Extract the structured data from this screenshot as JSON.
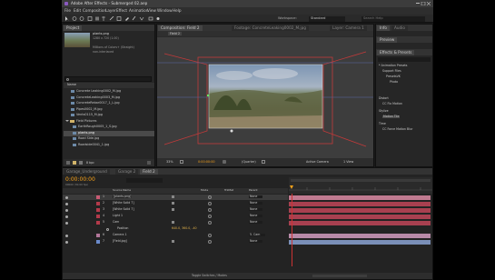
{
  "window": {
    "title": "Adobe After Effects - Submerged 02.aep"
  },
  "menu": [
    "File",
    "Edit",
    "Composition",
    "Layer",
    "Effect",
    "Animation",
    "View",
    "Window",
    "Help"
  ],
  "toolbar": {
    "workspace_label": "Workspace:",
    "workspace_value": "Standard",
    "search_placeholder": "Search Help"
  },
  "project": {
    "tab": "Project",
    "preview_name": "plants.png",
    "preview_info_1": "1280 x 720 (1.00)",
    "preview_info_2": "Millions of Colors+ (Straight)",
    "preview_info_3": "non-interlaced",
    "column_name": "Name",
    "items": [
      {
        "name": "Concrete Leaking0002_M.jpg",
        "type": "file"
      },
      {
        "name": "ConcreteLeaking0003_M.jpg",
        "type": "file"
      },
      {
        "name": "ConcreteRebar0017_1_L.jpg",
        "type": "file"
      },
      {
        "name": "Pipes0002_M.jpg",
        "type": "file"
      },
      {
        "name": "Vents0115_M.jpg",
        "type": "file"
      },
      {
        "name": "Field Pictures",
        "type": "folder"
      },
      {
        "name": "EarthRough0005_1_S.jpg",
        "type": "file"
      },
      {
        "name": "plants.png",
        "type": "file",
        "selected": true
      },
      {
        "name": "Road Side.jpg",
        "type": "file"
      },
      {
        "name": "Roadside0041_1.jpg",
        "type": "file"
      }
    ],
    "bpc": "8 bpc"
  },
  "composition": {
    "tab_comp": "Composition: Field 2",
    "tab_footage": "Footage: ConcreteLeaking0002_M.jpg",
    "tab_layer": "Layer: Camera 1",
    "breadcrumb": "Field 2",
    "zoom": "33%",
    "resolution": "(Quarter)",
    "view": "Active Camera",
    "views_count": "1 View",
    "timecode": "0:00:00:00"
  },
  "right_panel": {
    "info_tab": "Info",
    "audio_tab": "Audio",
    "preview_tab": "Preview",
    "effects_tab": "Effects & Presets",
    "tree": [
      "* Animation Presets",
      "Support Files",
      "PresetsVK",
      "Photo",
      "Distort",
      "CC Flo Motion",
      "Stylize",
      "Motion Tile",
      "Time",
      "CC Force Motion Blur"
    ]
  },
  "timeline": {
    "tabs": [
      "Garage_Underground",
      "Garage 2",
      "Field 2"
    ],
    "timecode": "0:00:00:00",
    "fps": "00000 (30.00 fps)",
    "col_source": "Source Name",
    "col_mode": "Mode",
    "col_trkmat": "TrkMat",
    "col_parent": "Parent",
    "layers": [
      {
        "num": "1",
        "name": "[plants.png]",
        "parent": "None",
        "color": "#c85a73"
      },
      {
        "num": "2",
        "name": "[White Solid 7]",
        "parent": "None",
        "color": "#b33a4a"
      },
      {
        "num": "3",
        "name": "[White Solid 7]",
        "parent": "None",
        "color": "#b33a4a"
      },
      {
        "num": "4",
        "name": "Light 1",
        "parent": "None",
        "color": "#b33a4a"
      },
      {
        "num": "5",
        "name": "Cam",
        "parent": "None",
        "color": "#b33a4a"
      },
      {
        "num": "",
        "name": "Position",
        "parent": "",
        "color": "",
        "value": "640.0, 360.0, -40"
      },
      {
        "num": "6",
        "name": "Camera 1",
        "parent": "5. Cam",
        "color": "#b2769a"
      },
      {
        "num": "7",
        "name": "[Field.jpg]",
        "parent": "None",
        "color": "#6a8acb"
      }
    ],
    "footer": "Toggle Switches / Modes"
  },
  "colors": {
    "accent": "#f7a21a",
    "bg": "#232323",
    "layer_red": "#b33a4a",
    "layer_blue": "#6a8acb"
  }
}
